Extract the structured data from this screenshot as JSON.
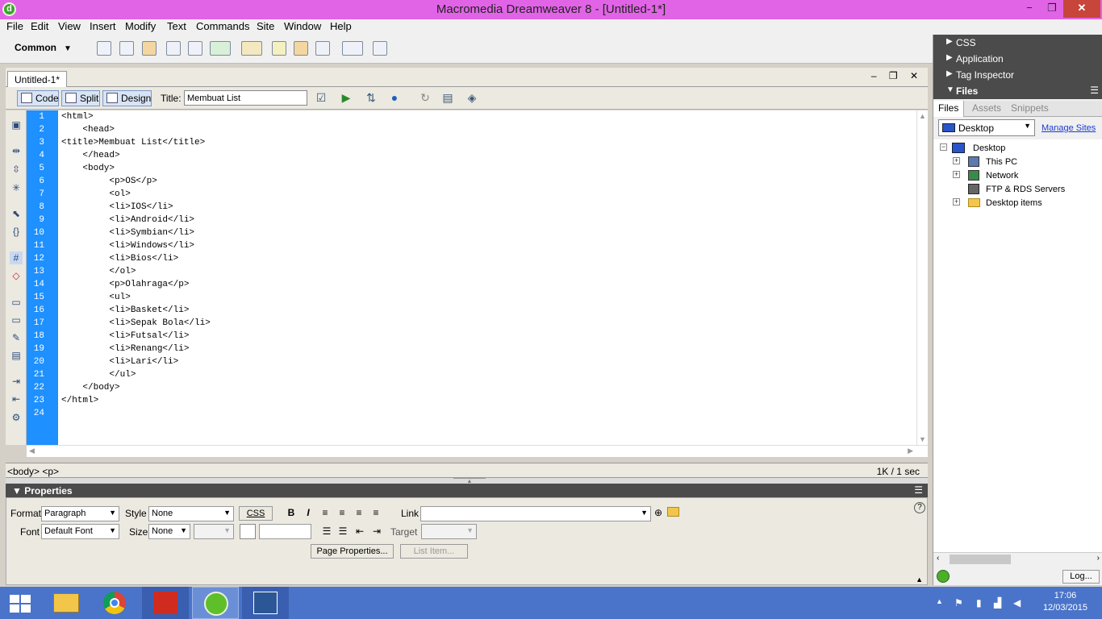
{
  "window": {
    "title": "Macromedia Dreamweaver 8 - [Untitled-1*]",
    "min": "−",
    "max": "❐",
    "close": "✕"
  },
  "menu": [
    "File",
    "Edit",
    "View",
    "Insert",
    "Modify",
    "Text",
    "Commands",
    "Site",
    "Window",
    "Help"
  ],
  "insert_bar": {
    "category": "Common"
  },
  "document": {
    "tab": "Untitled-1*",
    "views": {
      "code": "Code",
      "split": "Split",
      "design": "Design"
    },
    "title_label": "Title:",
    "title_value": "Membuat List",
    "line_numbers": [
      "1",
      "2",
      "3",
      "4",
      "5",
      "6",
      "7",
      "8",
      "9",
      "10",
      "11",
      "12",
      "13",
      "14",
      "15",
      "16",
      "17",
      "18",
      "19",
      "20",
      "21",
      "22",
      "23",
      "24"
    ],
    "code": "<html>\n    <head>\n<title>Membuat List</title>\n    </head>\n    <body>\n         <p>OS</p>\n         <ol>\n         <li>IOS</li>\n         <li>Android</li>\n         <li>Symbian</li>\n         <li>Windows</li>\n         <li>Bios</li>\n         </ol>\n         <p>Olahraga</p>\n         <ul>\n         <li>Basket</li>\n         <li>Sepak Bola</li>\n         <li>Futsal</li>\n         <li>Renang</li>\n         <li>Lari</li>\n         </ul>\n    </body>\n</html>\n",
    "tag_selector": "<body> <p>",
    "doc_size": "1K / 1 sec"
  },
  "properties": {
    "header": "Properties",
    "format_label": "Format",
    "format_value": "Paragraph",
    "style_label": "Style",
    "style_value": "None",
    "css_button": "CSS",
    "bold": "B",
    "italic": "I",
    "link_label": "Link",
    "link_value": "",
    "font_label": "Font",
    "font_value": "Default Font",
    "size_label": "Size",
    "size_value": "None",
    "target_label": "Target",
    "page_properties": "Page Properties...",
    "list_item": "List Item..."
  },
  "panels": {
    "css": "CSS",
    "application": "Application",
    "tag_inspector": "Tag Inspector",
    "files": "Files",
    "file_tabs": [
      "Files",
      "Assets",
      "Snippets"
    ],
    "site": "Desktop",
    "manage_sites": "Manage Sites",
    "tree": [
      "Desktop",
      "This PC",
      "Network",
      "FTP & RDS Servers",
      "Desktop items"
    ],
    "log_button": "Log..."
  },
  "taskbar": {
    "time": "17:06",
    "date": "12/03/2015"
  },
  "colors": {
    "titlebar": "#e164e6",
    "gutter": "#1e90ff",
    "taskbar": "#4a74c9",
    "panel_header": "#4b4b4b"
  }
}
